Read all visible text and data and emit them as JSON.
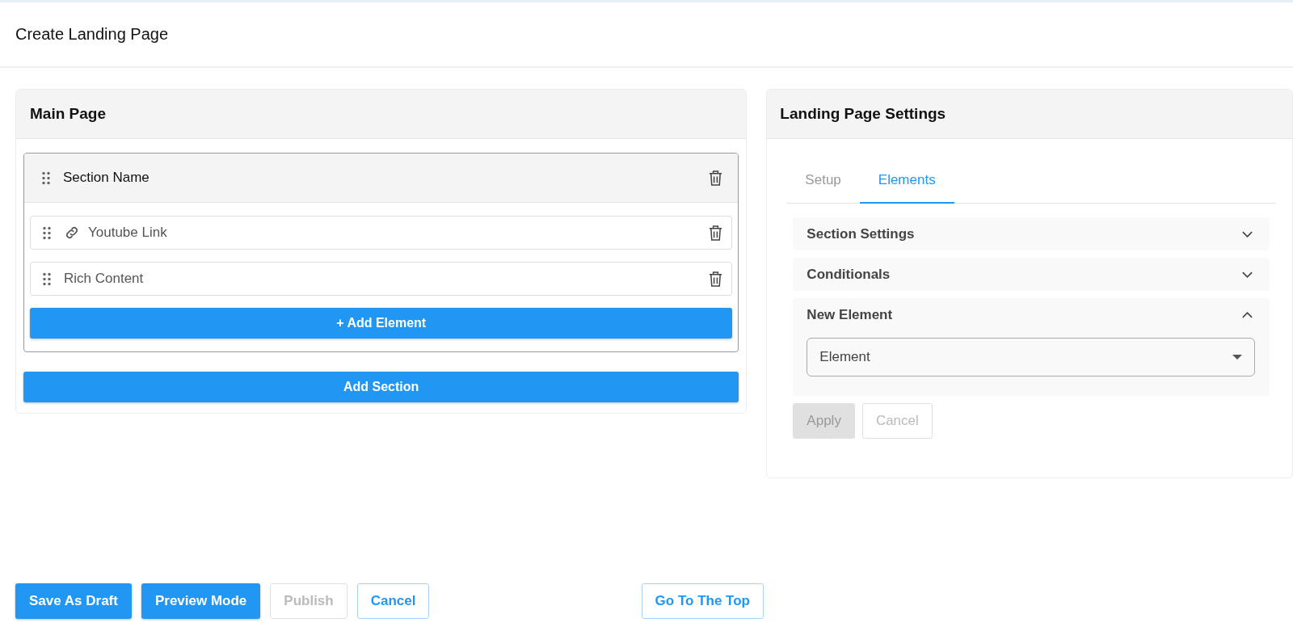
{
  "page_title": "Create Landing Page",
  "main_page": {
    "title": "Main Page",
    "section": {
      "name": "Section Name",
      "elements": [
        {
          "label": "Youtube Link",
          "kind": "link"
        },
        {
          "label": "Rich Content",
          "kind": "plain"
        }
      ],
      "add_element_button": "+ Add Element"
    },
    "add_section_button": "Add Section"
  },
  "settings": {
    "title": "Landing Page Settings",
    "tabs": [
      {
        "label": "Setup",
        "selected": false
      },
      {
        "label": "Elements",
        "selected": true
      }
    ],
    "accordions": [
      {
        "title": "Section Settings",
        "expanded": false
      },
      {
        "title": "Conditionals",
        "expanded": false
      },
      {
        "title": "New Element",
        "expanded": true,
        "select_value": "Element"
      }
    ],
    "buttons": [
      {
        "label": "Apply",
        "kind": "disabled-filled"
      },
      {
        "label": "Cancel",
        "kind": "disabled-outline"
      }
    ]
  },
  "footer_buttons": [
    {
      "label": "Save As Draft",
      "kind": "primary"
    },
    {
      "label": "Preview Mode",
      "kind": "primary"
    },
    {
      "label": "Publish",
      "kind": "disabled"
    },
    {
      "label": "Cancel",
      "kind": "outline"
    }
  ],
  "go_top_button": "Go To The Top"
}
